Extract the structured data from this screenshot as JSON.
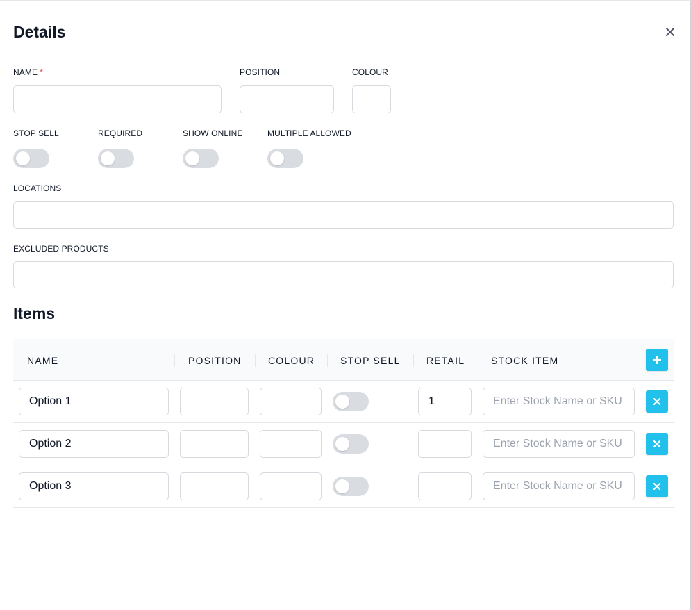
{
  "details": {
    "title": "Details",
    "close_icon": "close-icon",
    "name_label": "NAME",
    "name_required_mark": "*",
    "position_label": "POSITION",
    "colour_label": "COLOUR",
    "stop_sell_label": "STOP SELL",
    "required_label": "REQUIRED",
    "show_online_label": "SHOW ONLINE",
    "multiple_allowed_label": "MULTIPLE ALLOWED",
    "locations_label": "LOCATIONS",
    "excluded_products_label": "EXCLUDED PRODUCTS",
    "name_value": "",
    "position_value": "",
    "colour_value": "",
    "toggles": {
      "stop_sell": false,
      "required": false,
      "show_online": false,
      "multiple_allowed": false
    }
  },
  "items": {
    "title": "Items",
    "columns": [
      "NAME",
      "POSITION",
      "COLOUR",
      "STOP SELL",
      "RETAIL",
      "STOCK ITEM"
    ],
    "add_icon": "plus-icon",
    "remove_icon": "close-icon",
    "stock_placeholder": "Enter Stock Name or SKU",
    "rows": [
      {
        "name": "Option 1",
        "position": "",
        "colour": "",
        "stop_sell": false,
        "retail": "1",
        "stock_item": ""
      },
      {
        "name": "Option 2",
        "position": "",
        "colour": "",
        "stop_sell": false,
        "retail": "",
        "stock_item": ""
      },
      {
        "name": "Option 3",
        "position": "",
        "colour": "",
        "stop_sell": false,
        "retail": "",
        "stock_item": ""
      }
    ]
  },
  "colors": {
    "accent": "#22c1ec",
    "required": "#ef4444",
    "toggle_off": "#d9dce1",
    "text": "#111827",
    "border": "#d6d9de"
  }
}
